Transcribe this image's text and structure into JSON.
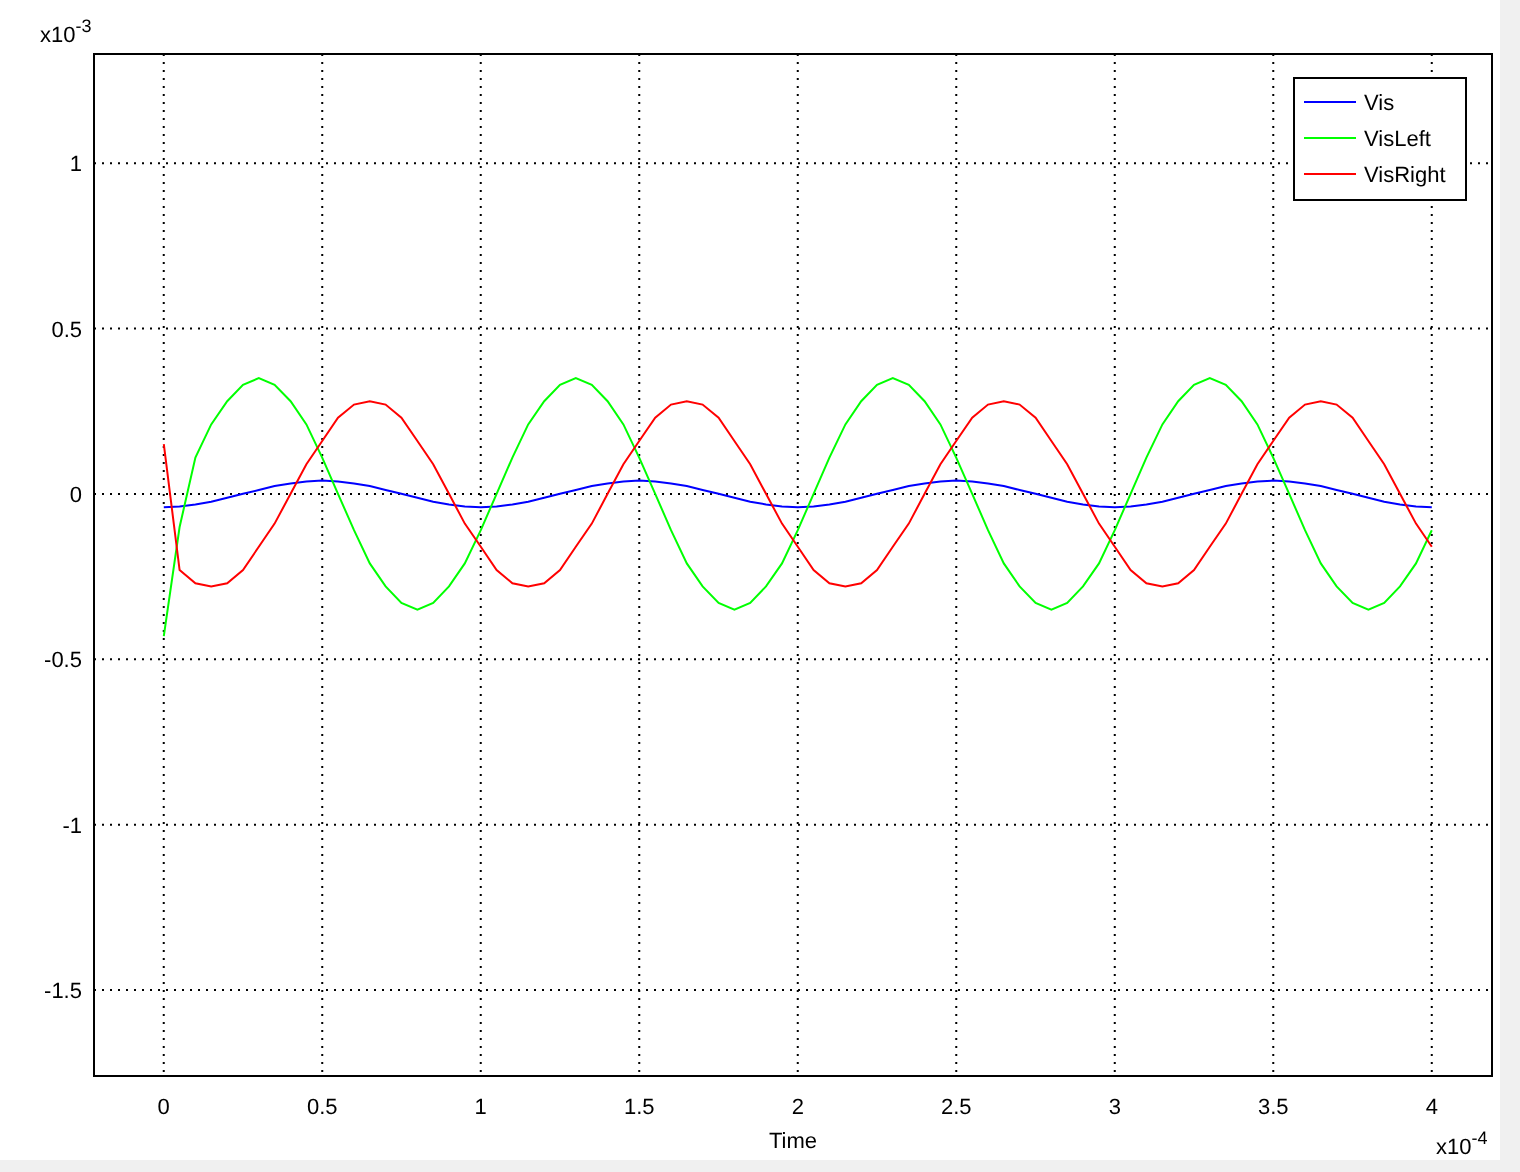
{
  "figure": {
    "y_exponent": {
      "base": "x10",
      "power": "-3"
    },
    "x_exponent": {
      "base": "x10",
      "power": "-4"
    },
    "chart_data": {
      "type": "line",
      "grid": true,
      "legend": true,
      "xlabel": "Time",
      "xlim": [
        -0.22,
        4.19
      ],
      "ylim": [
        -1.76,
        1.33
      ],
      "xticks": [
        {
          "value": 0,
          "label": "0"
        },
        {
          "value": 0.5,
          "label": "0.5"
        },
        {
          "value": 1,
          "label": "1"
        },
        {
          "value": 1.5,
          "label": "1.5"
        },
        {
          "value": 2,
          "label": "2"
        },
        {
          "value": 2.5,
          "label": "2.5"
        },
        {
          "value": 3,
          "label": "3"
        },
        {
          "value": 3.5,
          "label": "3.5"
        },
        {
          "value": 4,
          "label": "4"
        }
      ],
      "yticks": [
        {
          "value": -1.5,
          "label": "-1.5"
        },
        {
          "value": -1,
          "label": "-1"
        },
        {
          "value": -0.5,
          "label": "-0.5"
        },
        {
          "value": 0,
          "label": "0"
        },
        {
          "value": 0.5,
          "label": "0.5"
        },
        {
          "value": 1,
          "label": "1"
        }
      ],
      "x": [
        0,
        0.05,
        0.1,
        0.15,
        0.2,
        0.25,
        0.3,
        0.35,
        0.4,
        0.45,
        0.5,
        0.55,
        0.6,
        0.65,
        0.7,
        0.75,
        0.8,
        0.85,
        0.9,
        0.95,
        1,
        1.05,
        1.1,
        1.15,
        1.2,
        1.25,
        1.3,
        1.35,
        1.4,
        1.45,
        1.5,
        1.55,
        1.6,
        1.65,
        1.7,
        1.75,
        1.8,
        1.85,
        1.9,
        1.95,
        2,
        2.05,
        2.1,
        2.15,
        2.2,
        2.25,
        2.3,
        2.35,
        2.4,
        2.45,
        2.5,
        2.55,
        2.6,
        2.65,
        2.7,
        2.75,
        2.8,
        2.85,
        2.9,
        2.95,
        3,
        3.05,
        3.1,
        3.15,
        3.2,
        3.25,
        3.3,
        3.35,
        3.4,
        3.45,
        3.5,
        3.55,
        3.6,
        3.65,
        3.7,
        3.75,
        3.8,
        3.85,
        3.9,
        3.95,
        4
      ],
      "series": [
        {
          "name": "Vis",
          "color": "#0000ff",
          "values": [
            -0.04,
            -0.038,
            -0.032,
            -0.024,
            -0.012,
            0,
            0.012,
            0.024,
            0.032,
            0.038,
            0.04,
            0.038,
            0.032,
            0.024,
            0.012,
            0,
            -0.012,
            -0.024,
            -0.032,
            -0.038,
            -0.04,
            -0.038,
            -0.032,
            -0.024,
            -0.012,
            0,
            0.012,
            0.024,
            0.032,
            0.038,
            0.04,
            0.038,
            0.032,
            0.024,
            0.012,
            0,
            -0.012,
            -0.024,
            -0.032,
            -0.038,
            -0.04,
            -0.038,
            -0.032,
            -0.024,
            -0.012,
            0,
            0.012,
            0.024,
            0.032,
            0.038,
            0.04,
            0.038,
            0.032,
            0.024,
            0.012,
            0,
            -0.012,
            -0.024,
            -0.032,
            -0.038,
            -0.04,
            -0.038,
            -0.032,
            -0.024,
            -0.012,
            0,
            0.012,
            0.024,
            0.032,
            0.038,
            0.04,
            0.038,
            0.032,
            0.024,
            0.012,
            0,
            -0.012,
            -0.024,
            -0.032,
            -0.038,
            -0.04
          ]
        },
        {
          "name": "VisLeft",
          "color": "#00ff00",
          "values": [
            -0.43,
            -0.1,
            0.11,
            0.21,
            0.28,
            0.33,
            0.35,
            0.33,
            0.28,
            0.21,
            0.11,
            0,
            -0.11,
            -0.21,
            -0.28,
            -0.33,
            -0.35,
            -0.33,
            -0.28,
            -0.21,
            -0.11,
            0,
            0.11,
            0.21,
            0.28,
            0.33,
            0.35,
            0.33,
            0.28,
            0.21,
            0.11,
            0,
            -0.11,
            -0.21,
            -0.28,
            -0.33,
            -0.35,
            -0.33,
            -0.28,
            -0.21,
            -0.11,
            0,
            0.11,
            0.21,
            0.28,
            0.33,
            0.35,
            0.33,
            0.28,
            0.21,
            0.11,
            0,
            -0.11,
            -0.21,
            -0.28,
            -0.33,
            -0.35,
            -0.33,
            -0.28,
            -0.21,
            -0.11,
            0,
            0.11,
            0.21,
            0.28,
            0.33,
            0.35,
            0.33,
            0.28,
            0.21,
            0.11,
            0,
            -0.11,
            -0.21,
            -0.28,
            -0.33,
            -0.35,
            -0.33,
            -0.28,
            -0.21,
            -0.11
          ]
        },
        {
          "name": "VisRight",
          "color": "#ff0000",
          "values": [
            0.15,
            -0.23,
            -0.27,
            -0.28,
            -0.27,
            -0.23,
            -0.16,
            -0.09,
            0,
            0.09,
            0.16,
            0.23,
            0.27,
            0.28,
            0.27,
            0.23,
            0.16,
            0.09,
            0,
            -0.09,
            -0.16,
            -0.23,
            -0.27,
            -0.28,
            -0.27,
            -0.23,
            -0.16,
            -0.09,
            0,
            0.09,
            0.16,
            0.23,
            0.27,
            0.28,
            0.27,
            0.23,
            0.16,
            0.09,
            0,
            -0.09,
            -0.16,
            -0.23,
            -0.27,
            -0.28,
            -0.27,
            -0.23,
            -0.16,
            -0.09,
            0,
            0.09,
            0.16,
            0.23,
            0.27,
            0.28,
            0.27,
            0.23,
            0.16,
            0.09,
            0,
            -0.09,
            -0.16,
            -0.23,
            -0.27,
            -0.28,
            -0.27,
            -0.23,
            -0.16,
            -0.09,
            0,
            0.09,
            0.16,
            0.23,
            0.27,
            0.28,
            0.27,
            0.23,
            0.16,
            0.09,
            0,
            -0.09,
            -0.16
          ]
        }
      ]
    }
  }
}
